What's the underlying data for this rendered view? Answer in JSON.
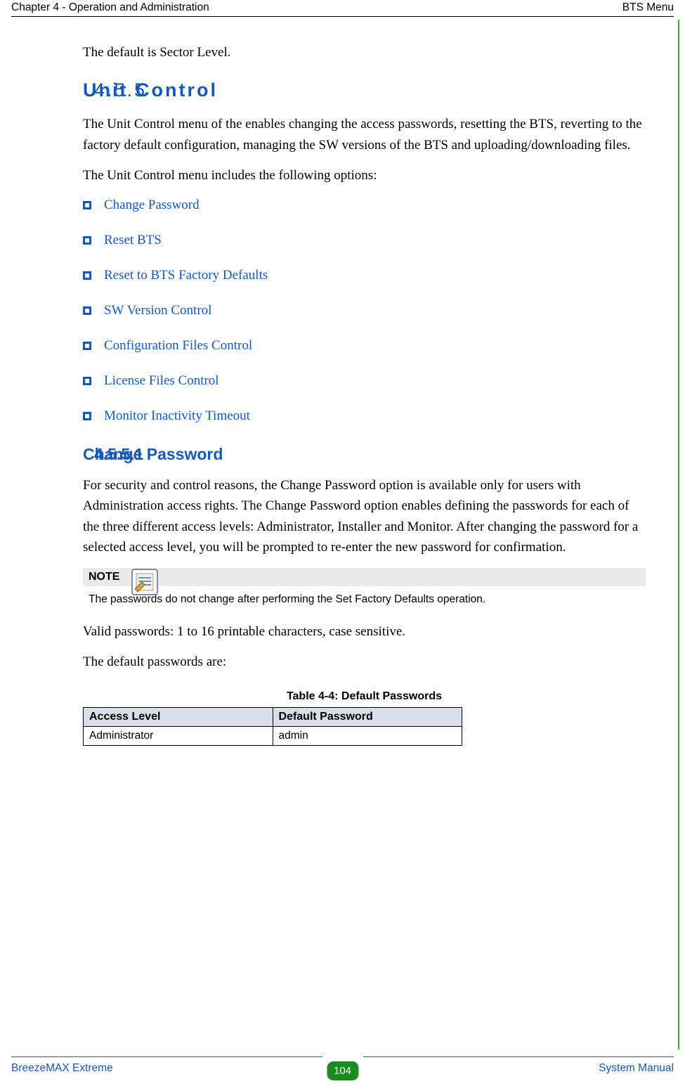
{
  "header": {
    "left": "Chapter 4 - Operation and Administration",
    "right": "BTS Menu"
  },
  "intro_line": "The default is Sector Level.",
  "section": {
    "num": "4.5.5",
    "title": "Unit Control",
    "para1": "The Unit Control menu of the enables changing the access passwords, resetting the BTS, reverting to the factory default configuration, managing the SW versions of the BTS and uploading/downloading files.",
    "para2": "The Unit Control menu includes the following options:",
    "options": [
      "Change Password",
      "Reset BTS",
      "Reset to BTS Factory Defaults",
      "SW Version Control",
      "Configuration Files Control",
      "License Files Control",
      "Monitor Inactivity Timeout"
    ]
  },
  "subsection": {
    "num": "4.5.5.1",
    "title": "Change Password",
    "para": "For security and control reasons, the Change Password option is available only for users with Administration access rights. The Change Password option enables defining the passwords for each of the three different access levels: Administrator, Installer and Monitor. After changing the password for a selected access level, you will be prompted to re-enter the new password for confirmation."
  },
  "note": {
    "label": "NOTE",
    "text": "The passwords do not change after performing the Set Factory Defaults operation."
  },
  "post_note1": "Valid passwords: 1 to 16 printable characters, case sensitive.",
  "post_note2": "The default passwords are:",
  "table": {
    "caption": "Table 4-4: Default Passwords",
    "head_access": "Access Level",
    "head_pw": "Default Password",
    "rows": [
      {
        "access": "Administrator",
        "pw": "admin"
      }
    ]
  },
  "footer": {
    "left": "BreezeMAX Extreme",
    "page": "104",
    "right": "System Manual"
  }
}
